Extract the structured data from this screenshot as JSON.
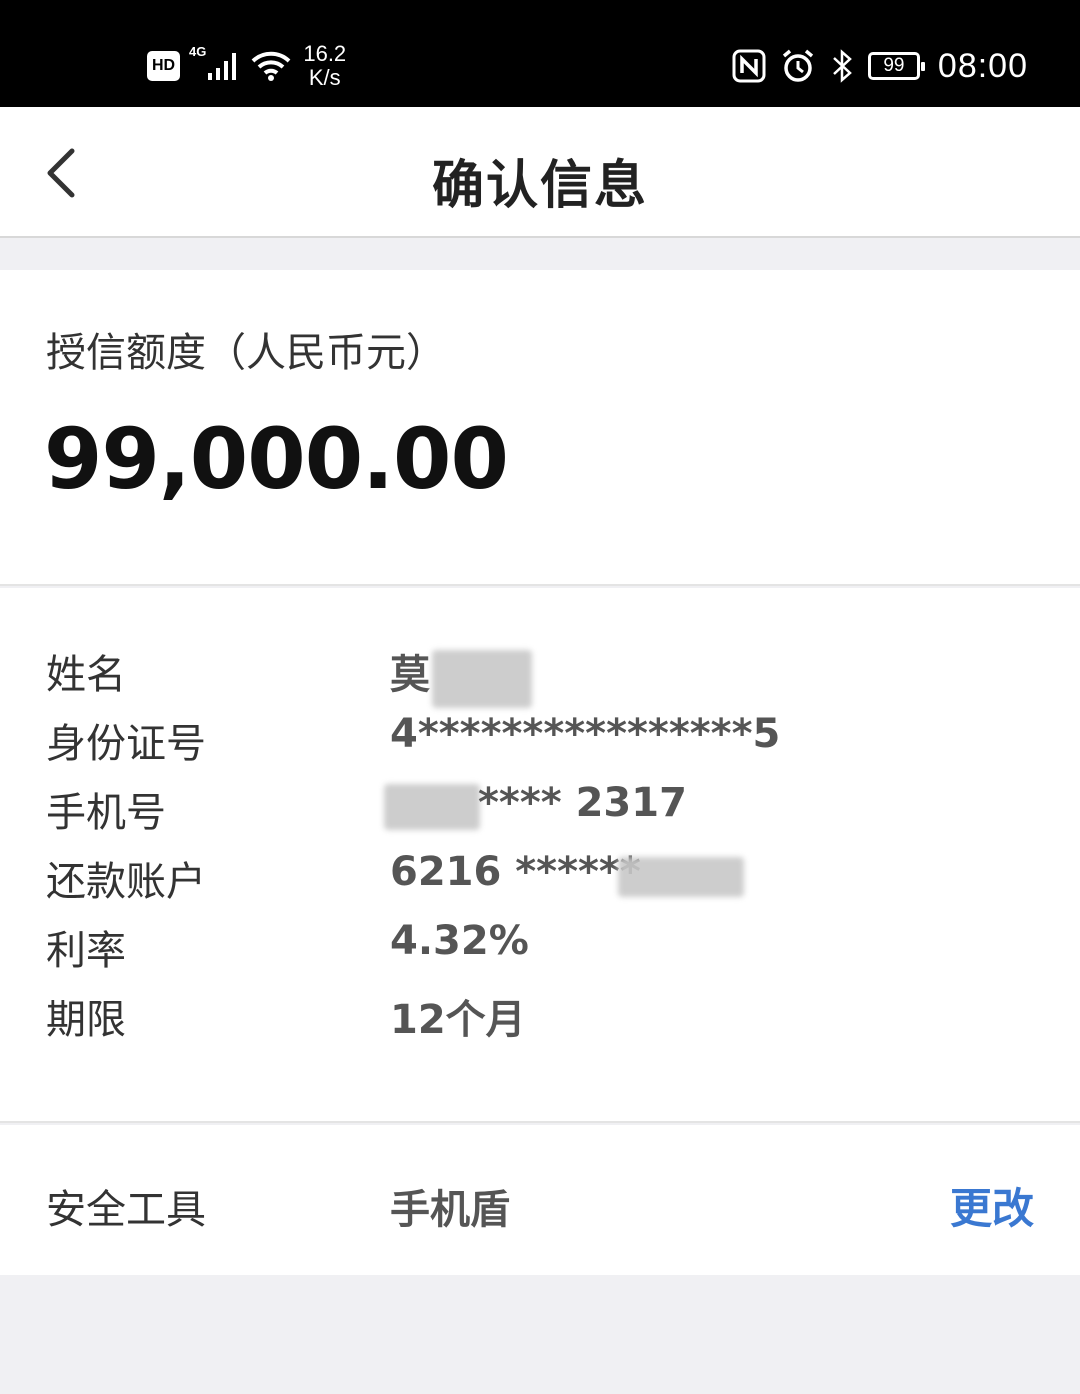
{
  "status_bar": {
    "hd": "HD",
    "network": "4G",
    "speed_value": "16.2",
    "speed_unit": "K/s",
    "battery": "99",
    "time": "08:00"
  },
  "nav": {
    "title": "确认信息"
  },
  "credit": {
    "label": "授信额度（人民币元）",
    "amount": "99,000.00"
  },
  "info": {
    "rows": [
      {
        "label": "姓名",
        "value": "莫"
      },
      {
        "label": "身份证号",
        "value": "4****************5"
      },
      {
        "label": "手机号",
        "value": "**** 2317"
      },
      {
        "label": "还款账户",
        "value": "6216 ******"
      },
      {
        "label": "利率",
        "value": "4.32%"
      },
      {
        "label": "期限",
        "value": "12个月"
      }
    ]
  },
  "security": {
    "label": "安全工具",
    "value": "手机盾",
    "change_label": "更改"
  },
  "colors": {
    "accent": "#3a78d1",
    "page_bg": "#f0f0f3"
  }
}
